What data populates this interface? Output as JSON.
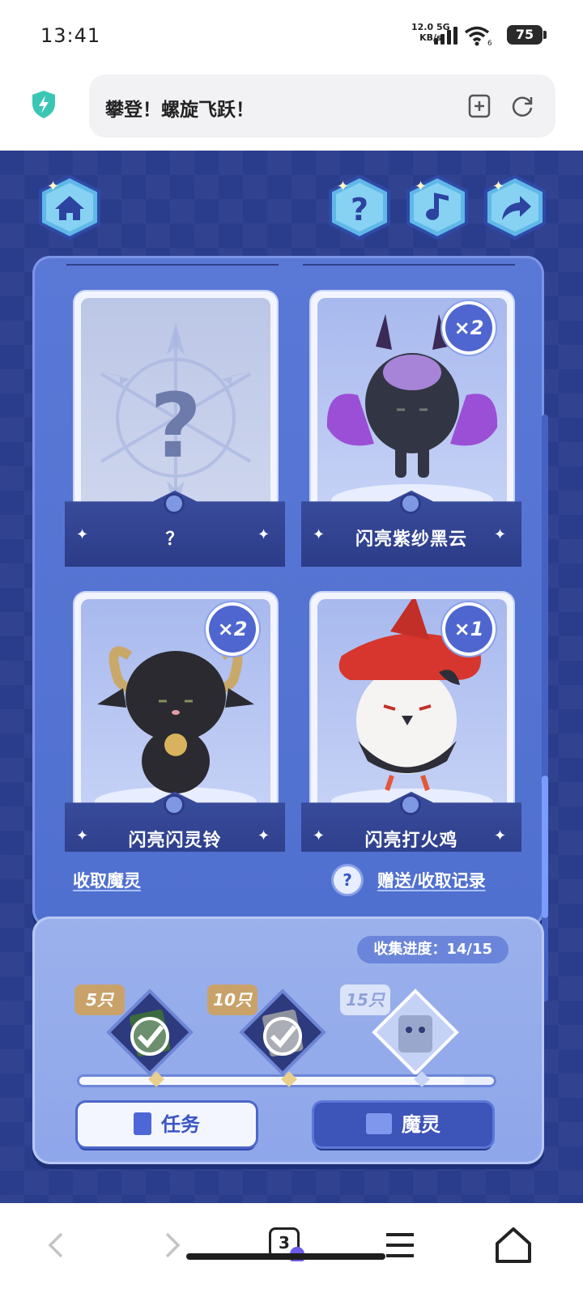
{
  "status_bar": {
    "time": "13:41",
    "net_speed_value": "12.0",
    "net_speed_unit": "KB/s",
    "net_type": "5G",
    "wifi_badge": "6",
    "battery": "75"
  },
  "url_bar": {
    "title": "攀登！螺旋飞跃！"
  },
  "game": {
    "top_buttons": [
      "home-icon",
      "question-icon",
      "music-icon",
      "share-icon"
    ],
    "cards": [
      {
        "name": "？",
        "count": "",
        "unknown": true
      },
      {
        "name": "闪亮紫纱黑云",
        "count": "×2",
        "unknown": false
      },
      {
        "name": "闪亮闪灵铃",
        "count": "×2",
        "unknown": false
      },
      {
        "name": "闪亮打火鸡",
        "count": "×1",
        "unknown": false
      }
    ],
    "collect_link": "收取魔灵",
    "help_glyph": "?",
    "records_link": "赠送/收取记录",
    "progress_label": "收集进度：",
    "progress_value": "14/15",
    "progress_fraction": 0.93,
    "milestones": [
      {
        "label": "5只",
        "done": true
      },
      {
        "label": "10只",
        "done": true
      },
      {
        "label": "15只",
        "done": false
      }
    ],
    "task_button": "任务",
    "spirit_button": "魔灵",
    "colors": {
      "panel": "#5a78d6",
      "background": "#2a3d8c",
      "accent": "#3d54b8"
    }
  },
  "nav": {
    "tab_count": "3"
  }
}
